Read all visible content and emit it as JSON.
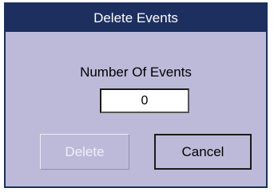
{
  "dialog": {
    "title": "Delete Events",
    "field_label": "Number Of Events",
    "number_of_events": "0",
    "buttons": {
      "delete_label": "Delete",
      "cancel_label": "Cancel"
    }
  },
  "colors": {
    "titlebar": "#1c2f5e",
    "background": "#bdbad9",
    "disabled_text": "#f0eef8"
  }
}
